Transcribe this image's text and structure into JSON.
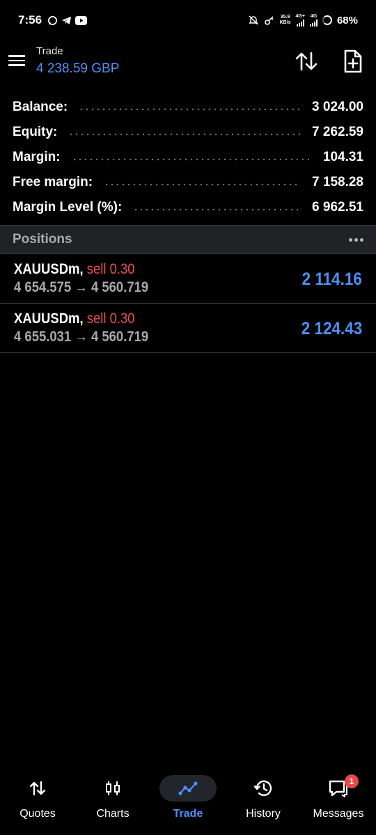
{
  "status_bar": {
    "time": "7:56",
    "left_icons": [
      "whatsapp-icon",
      "telegram-icon",
      "youtube-icon"
    ],
    "net_speed_value": "35.9",
    "net_speed_unit": "KB/s",
    "signal1_label": "4G+",
    "signal2_label": "4G",
    "battery": "68%"
  },
  "header": {
    "title": "Trade",
    "subtitle": "4 238.59 GBP",
    "icons": [
      "menu-icon",
      "sort-icon",
      "new-order-icon"
    ]
  },
  "summary": [
    {
      "label": "Balance:",
      "value": "3 024.00"
    },
    {
      "label": "Equity:",
      "value": "7 262.59"
    },
    {
      "label": "Margin:",
      "value": "104.31"
    },
    {
      "label": "Free margin:",
      "value": "7 158.28"
    },
    {
      "label": "Margin Level (%):",
      "value": "6 962.51"
    }
  ],
  "positions": {
    "title": "Positions",
    "items": [
      {
        "symbol": "XAUUSDm,",
        "side": "sell 0.30",
        "prices": "4 654.575 → 4 560.719",
        "profit": "2 114.16"
      },
      {
        "symbol": "XAUUSDm,",
        "side": "sell 0.30",
        "prices": "4 655.031 → 4 560.719",
        "profit": "2 124.43"
      }
    ]
  },
  "nav": {
    "items": [
      {
        "label": "Quotes",
        "icon": "quotes-icon"
      },
      {
        "label": "Charts",
        "icon": "charts-icon"
      },
      {
        "label": "Trade",
        "icon": "trade-icon",
        "active": true
      },
      {
        "label": "History",
        "icon": "history-icon"
      },
      {
        "label": "Messages",
        "icon": "messages-icon",
        "badge": "1"
      }
    ]
  },
  "colors": {
    "accent": "#4f8ff5",
    "sell": "#ef4e4e",
    "background": "#000000",
    "section": "#212226"
  }
}
